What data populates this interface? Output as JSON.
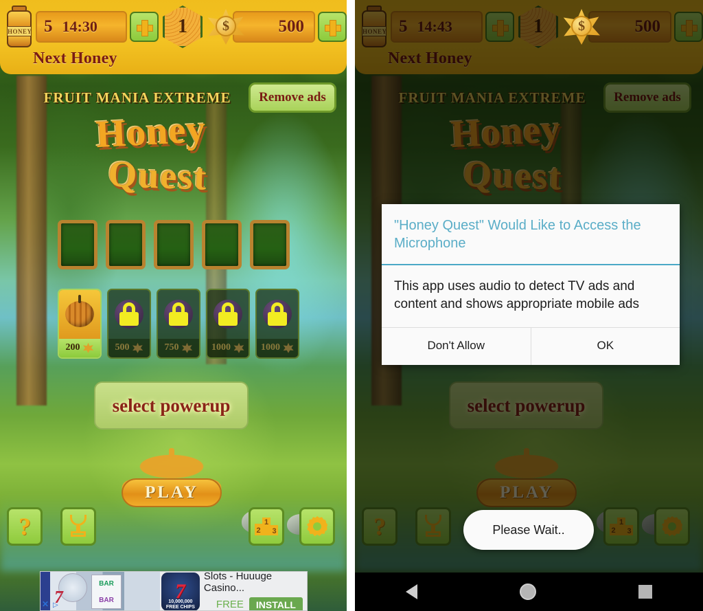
{
  "app": {
    "title": "Honey Quest",
    "publisher_banner": "FRUIT MANIA EXTREME"
  },
  "hud": {
    "honey_count": "5",
    "honey_timer": "14:30",
    "honey_timer_right": "14:43",
    "next_honey_label": "Next Honey",
    "level_badge": "1",
    "coins": "500",
    "add_honey_label": "+",
    "add_coins_label": "+",
    "jar_label": "HONEY",
    "coin_symbol": "$"
  },
  "header": {
    "remove_ads_label": "Remove ads",
    "logo_line1": "Honey",
    "logo_line2": "Quest"
  },
  "board": {
    "slot_count": 5
  },
  "powerups": {
    "items": [
      {
        "price": "200",
        "locked": false,
        "art": "pumpkin-icon"
      },
      {
        "price": "500",
        "locked": true,
        "art": "lock-icon"
      },
      {
        "price": "750",
        "locked": true,
        "art": "lock-icon"
      },
      {
        "price": "1000",
        "locked": true,
        "art": "lock-icon"
      },
      {
        "price": "1000",
        "locked": true,
        "art": "lock-icon"
      }
    ]
  },
  "actions": {
    "select_powerup_label": "select powerup",
    "play_label": "PLAY"
  },
  "corner_buttons": [
    {
      "name": "help-button",
      "icon": "question-mark-icon"
    },
    {
      "name": "achievements-button",
      "icon": "trophy-icon"
    },
    {
      "name": "leaderboard-button",
      "icon": "podium-icon"
    },
    {
      "name": "settings-button",
      "icon": "gear-icon"
    }
  ],
  "podium": {
    "first": "1",
    "second": "2",
    "third": "3"
  },
  "ad_banner": {
    "title": "Slots - Huuuge Casino...",
    "free_label": "FREE",
    "install_label": "INSTALL",
    "creative_bar_text": "BAR",
    "creative_bar_text2": "BAR",
    "icon_seven": "7",
    "icon_chips_line1": "10,000,000",
    "icon_chips_line2": "FREE CHIPS"
  },
  "permission_dialog": {
    "title": "\"Honey Quest\" Would Like to Access the Microphone",
    "message": "This app uses audio to detect TV ads and content and shows appropriate mobile ads",
    "deny_label": "Don't Allow",
    "allow_label": "OK"
  },
  "toast": {
    "text": "Please Wait.."
  },
  "navbar": {
    "back": "back-triangle-icon",
    "home": "home-circle-icon",
    "recents": "recents-square-icon"
  },
  "colors": {
    "hud_yellow": "#f3c323",
    "dialog_title_blue": "#5aadc7",
    "accent_green": "#8fcb3d",
    "text_maroon": "#7a1c13",
    "install_green": "#6aa84f"
  }
}
